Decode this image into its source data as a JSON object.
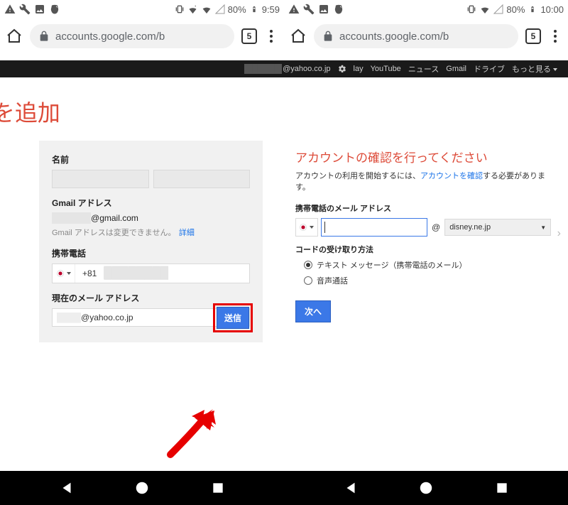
{
  "left": {
    "status": {
      "battery": "80%",
      "time": "9:59"
    },
    "url": "accounts.google.com/b",
    "tabcount": "5",
    "page": {
      "title_fragment": "ail を追加",
      "section_name": "名前",
      "section_gmail": "Gmail アドレス",
      "gmail_suffix": "@gmail.com",
      "gmail_hint": "Gmail アドレスは変更できません。",
      "gmail_link": "詳細",
      "section_phone": "携帯電話",
      "phone_prefix": "+81",
      "section_current": "現在のメール アドレス",
      "current_suffix": "@yahoo.co.jp",
      "submit": "送信"
    }
  },
  "right": {
    "status": {
      "battery": "80%",
      "time": "10:00"
    },
    "url": "accounts.google.com/b",
    "tabcount": "5",
    "page": {
      "title": "アカウントの確認を行ってください",
      "subtitle_pre": "アカウントの利用を開始するには、",
      "subtitle_link": "アカウントを確認",
      "subtitle_post": "する必要があります。",
      "section_phone_email": "携帯電話のメール アドレス",
      "domain": "disney.ne.jp",
      "section_method": "コードの受け取り方法",
      "opt_text": "テキスト メッセージ（携帯電話のメール）",
      "opt_voice": "音声通話",
      "next": "次へ"
    }
  },
  "gbar": {
    "email_suffix": "@yahoo.co.jp",
    "items": [
      "lay",
      "YouTube",
      "ニュース",
      "Gmail",
      "ドライブ",
      "もっと見る"
    ]
  }
}
